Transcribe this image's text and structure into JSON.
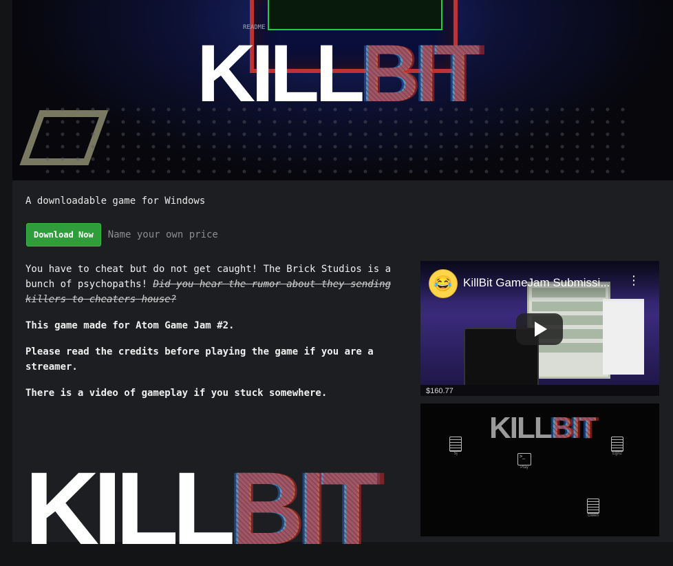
{
  "banner": {
    "logo_left": "KILL",
    "logo_right": "BIT",
    "readme_label": "README"
  },
  "subtitle": "A downloadable game for Windows",
  "buy": {
    "download_label": "Download Now",
    "price_hint": "Name your own price"
  },
  "description": {
    "p1_text": "You have to cheat but do not get caught! The Brick Studios is a bunch of psychopaths! ",
    "p1_strike": "Did you hear the rumor about they sending killers to cheaters house? ",
    "p2": "This game made for Atom Game Jam #2.",
    "p3": "Please read the credits before playing the game if you are a streamer.",
    "p4": "There is a video of gameplay if you stuck somewhere."
  },
  "logo2": {
    "left": "KILL",
    "right": "BIT"
  },
  "video": {
    "title": "KillBit GameJam Submissi...",
    "money": "$160.77",
    "avatar_icon": "laughing-emoji-icon",
    "menu_icon": "more-vertical-icon",
    "play_icon": "play-icon"
  },
  "screenshot": {
    "logo_left": "KILL",
    "logo_right": "BIT",
    "files": [
      {
        "label": "Sj"
      },
      {
        "label": "Play"
      },
      {
        "label": "Egn2"
      },
      {
        "label": "Gwen"
      }
    ],
    "terminal_glyph": ">_"
  },
  "colors": {
    "page_bg": "#1c1e21",
    "outer_bg": "#131416",
    "download_green": "#2f9d3c"
  }
}
